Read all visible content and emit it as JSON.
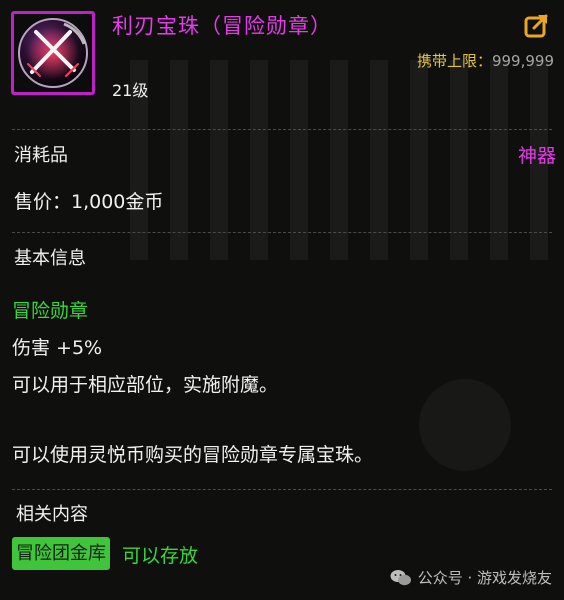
{
  "item": {
    "name": "利刃宝珠（冒险勋章）",
    "level": "21级",
    "carry_label": "携带上限：",
    "carry_value": "999,999",
    "type": "消耗品",
    "grade": "神器",
    "price": "售价：1,000金币",
    "icon": "crossed-swords-orb-icon"
  },
  "basic_info": {
    "title": "基本信息",
    "effect_name": "冒险勋章",
    "lines": [
      "伤害 +5%",
      "可以用于相应部位，实施附魔。",
      "可以使用灵悦币购买的冒险勋章专属宝珠。"
    ]
  },
  "related": {
    "title": "相关内容",
    "badge": "冒险团金库",
    "storable": "可以存放"
  },
  "watermark": {
    "text": "公众号 · 游戏发烧友",
    "icon": "wechat-icon"
  },
  "colors": {
    "name": "#e53bea",
    "grade": "#e53bea",
    "carry_label": "#e3c344",
    "effect": "#37d83a",
    "badge_bg": "#3fc43b",
    "border": "#c020c8"
  }
}
